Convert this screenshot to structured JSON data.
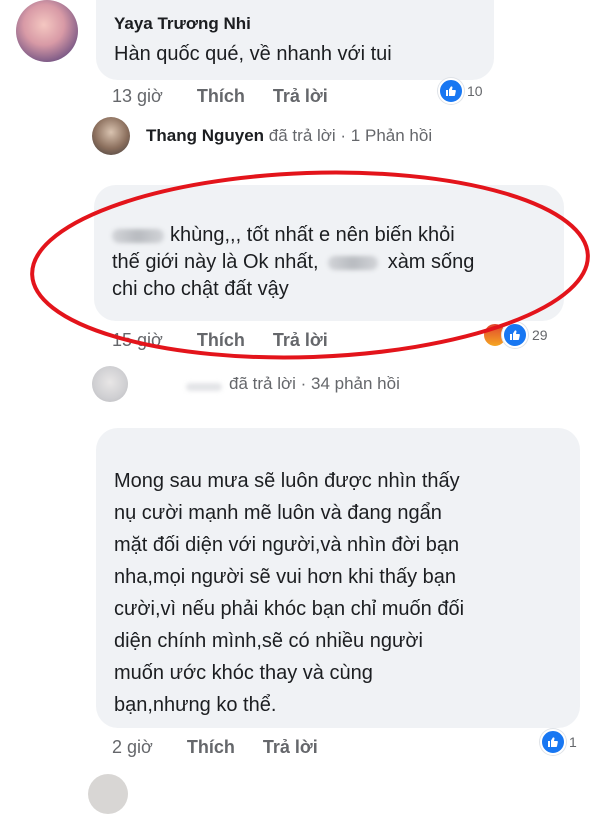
{
  "comment1": {
    "author": "Yaya Trương Nhi",
    "text": "Hàn quốc qué, về nhanh với tui",
    "time": "13 giờ",
    "like": "Thích",
    "reply": "Trả lời",
    "reaction_count": "10"
  },
  "reply_summary1": {
    "name": "Thang Nguyen",
    "suffix": "đã trả lời · 1 Phản hồi"
  },
  "comment2": {
    "lines": [
      "khùng,,, tốt nhất e nên biến khỏi",
      "thế giới này là Ok nhất,",
      "xàm sống",
      "chi cho chật đất vậy"
    ],
    "time": "15 giờ",
    "like": "Thích",
    "reply": "Trả lời",
    "reaction_count": "29"
  },
  "reply_summary2": {
    "suffix": "đã trả lời · 34 phản hồi"
  },
  "comment3": {
    "lines": [
      "Mong sau mưa sẽ luôn được nhìn thấy",
      "nụ cười mạnh mẽ luôn và đang ngẩn",
      "mặt đối diện với người,và nhìn đời bạn",
      "nha,mọi người sẽ vui hơn khi thấy bạn",
      "cười,vì nếu phải khóc bạn chỉ muốn đối",
      "diện chính mình,sẽ có nhiều người",
      "muốn ước khóc thay và cùng",
      "bạn,nhưng ko thể."
    ],
    "time": "2 giờ",
    "like": "Thích",
    "reply": "Trả lời",
    "reaction_count": "1"
  },
  "colors": {
    "bubble": "#f0f2f5",
    "like_blue": "#1877f2",
    "highlight_red": "#e3141b",
    "meta_gray": "#65676b"
  }
}
